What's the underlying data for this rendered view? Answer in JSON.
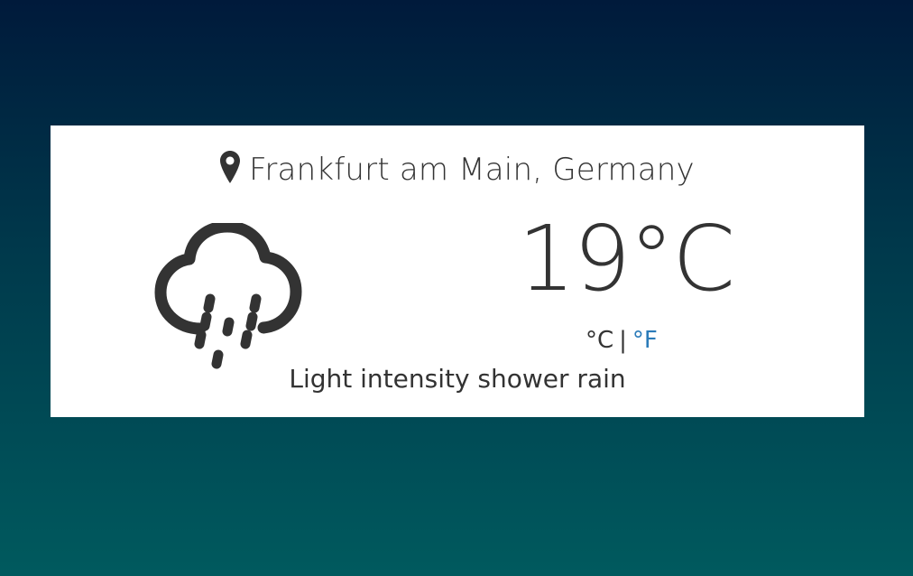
{
  "location": {
    "name": "Frankfurt am Main, Germany",
    "icon": "map-pin-icon"
  },
  "weather": {
    "icon": "cloud-rain-icon",
    "temperature": "19°C",
    "condition": "Light intensity shower rain"
  },
  "units": {
    "celsius": "°C",
    "separator": "|",
    "fahrenheit": "°F",
    "active": "C"
  },
  "colors": {
    "background_top": "#001a3b",
    "background_bottom": "#005a5e",
    "card": "#ffffff",
    "text": "#333333",
    "link": "#2b7bb9"
  }
}
